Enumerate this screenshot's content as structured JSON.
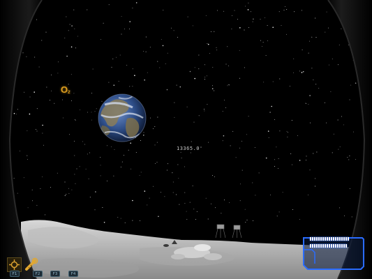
{
  "hud": {
    "o2_label": "O",
    "o2_sub": "2",
    "distance": "13365.0",
    "gauge_top_level": 0.85,
    "gauge_bottom_level": 0.8,
    "accent_color": "#2a6cff",
    "o2_color": "#e0a020"
  },
  "hotbar": {
    "slots": [
      {
        "key": "F1",
        "icon": "crosshair-gear-icon"
      },
      {
        "key": "F2",
        "icon": "wrench-icon"
      },
      {
        "key": "F3",
        "icon": "empty-slot"
      },
      {
        "key": "F4",
        "icon": "empty-slot"
      }
    ]
  },
  "scene": {
    "sky": "starfield",
    "planet": "earth",
    "terrain": "lunar-surface"
  }
}
